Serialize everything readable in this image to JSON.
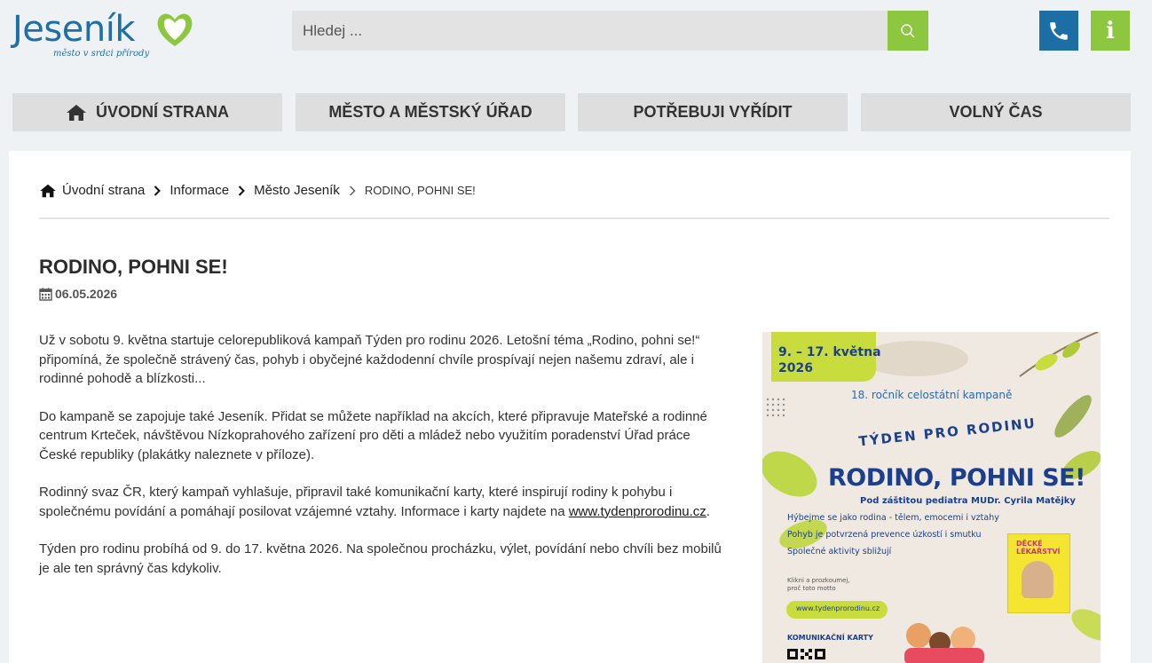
{
  "header": {
    "logo_text": "Jeseník",
    "logo_tagline": "město v srdci přírody",
    "search_placeholder": "Hledej ...",
    "icons": [
      "search-icon",
      "phone-icon",
      "info-icon"
    ],
    "info_label": "i"
  },
  "colors": {
    "brand_blue": "#1c6ea4",
    "brand_green": "#8dc63f",
    "nav_bg": "#dedede",
    "page_bg": "#eef2f5"
  },
  "nav": {
    "items": [
      {
        "label": "ÚVODNÍ STRANA",
        "icon": "home-icon"
      },
      {
        "label": "MĚSTO A MĚSTSKÝ ÚŘAD"
      },
      {
        "label": "POTŘEBUJI VYŘÍDIT"
      },
      {
        "label": "VOLNÝ ČAS"
      }
    ]
  },
  "breadcrumb": {
    "items": [
      "Úvodní strana",
      "Informace",
      "Město Jeseník"
    ],
    "current": "RODINO, POHNI SE!"
  },
  "article": {
    "title": "RODINO, POHNI SE!",
    "date": "06.05.2026",
    "p1": "Už v sobotu 9. května startuje celorepubliková kampaň Týden pro rodinu 2026. Letošní téma „Rodino, pohni se!“ připomíná, že společně strávený čas, pohyb i obyčejné každodenní chvíle prospívají nejen našemu zdraví, ale i rodinné pohodě a blízkosti...",
    "p2": "Do kampaně se zapojuje také Jeseník. Přidat se můžete například na akcích, které připravuje Mateřské a rodinné centrum Krteček, návštěvou Nízkoprahového zařízení pro děti a mládež nebo využitím poradenství Úřad práce České republiky (plakátky naleznete v příloze).",
    "p3_before": "Rodinný svaz ČR, který kampaň vyhlašuje, připravil také komunikační karty, které inspirují rodiny k pohybu i společnému povídání a pomáhají posilovat vzájemné vztahy. Informace i karty najdete na ",
    "p3_link": "www.tydenprorodinu.cz",
    "p3_after": ".",
    "p4": "Týden pro rodinu probíhá od 9. do 17. května 2026. Na společnou procházku, výlet, povídání nebo chvíli bez mobilů je ale ten správný čas kdykoliv."
  },
  "poster": {
    "date_line1": "9. – 17. května",
    "date_line2": "2026",
    "rocnik": "18. ročník celostátní kampaně",
    "tyden": "TÝDEN PRO RODINU",
    "main": "RODINO, POHNI SE!",
    "pod": "Pod záštitou pediatra MUDr. Cyrila Matějky",
    "line1": "Hýbejme se jako rodina - tělem, emocemi i vztahy",
    "line2": "Pohyb je potvrzená prevence úzkostí i smutku",
    "line3": "Společné aktivity sbližují",
    "book_title1": "DĚCKÉ",
    "book_title2": "LÉKAŘSTVÍ",
    "small1": "Klikni a prozkoumej,",
    "small2": "proč toto motto",
    "url": "www.tydenprorodinu.cz",
    "komun": "KOMUNIKAČNÍ KARTY"
  }
}
